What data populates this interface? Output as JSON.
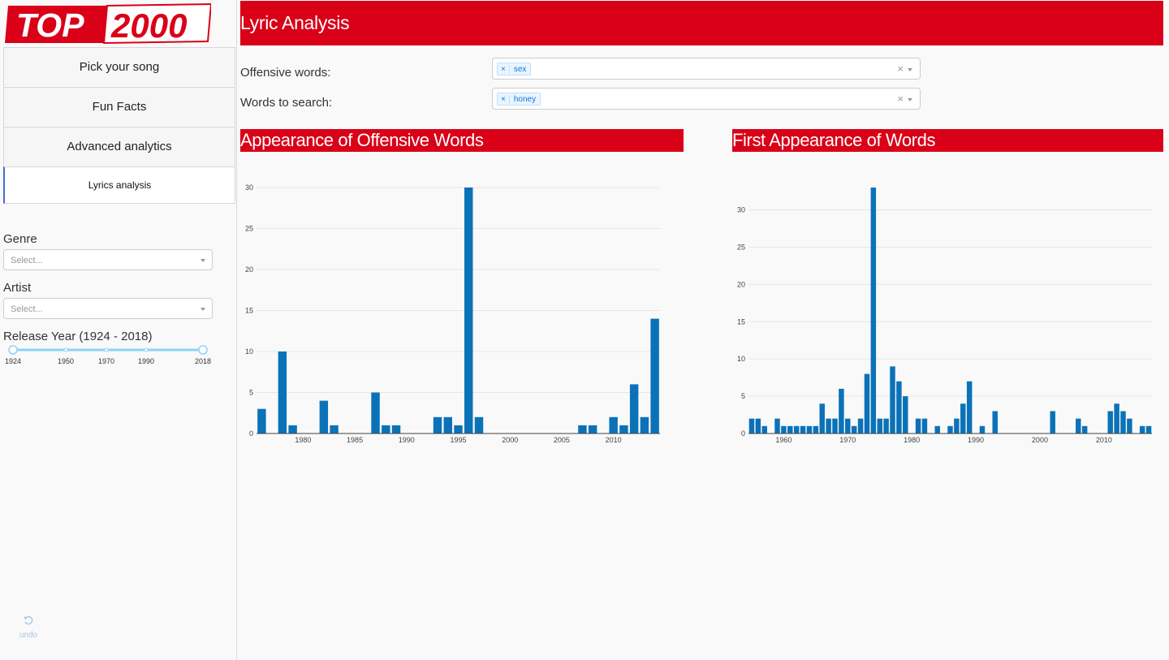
{
  "sidebar": {
    "logo": {
      "part1": "TOP",
      "part2": "2000"
    },
    "nav": [
      {
        "label": "Pick your song",
        "active": false
      },
      {
        "label": "Fun Facts",
        "active": false
      },
      {
        "label": "Advanced analytics",
        "active": false
      },
      {
        "label": "Lyrics analysis",
        "active": true
      }
    ],
    "genre": {
      "label": "Genre",
      "placeholder": "Select..."
    },
    "artist": {
      "label": "Artist",
      "placeholder": "Select..."
    },
    "release_year": {
      "label": "Release Year (1924 - 2018)",
      "min": 1924,
      "max": 2018,
      "selected": [
        1924,
        2018
      ],
      "marks": [
        "1924",
        "1950",
        "1970",
        "1990",
        "2018"
      ]
    },
    "undo_label": "undo"
  },
  "header": {
    "title": "Lyric Analysis"
  },
  "filters": {
    "offensive_label": "Offensive words:",
    "offensive_values": [
      "sex"
    ],
    "search_label": "Words to search:",
    "search_values": [
      "honey"
    ],
    "clear_glyph": "×",
    "remove_glyph": "×"
  },
  "colors": {
    "accent": "#d90018",
    "bar": "#0b72b8"
  },
  "chart_titles": {
    "left": "Appearance of Offensive Words",
    "right": "First Appearance of Words"
  },
  "chart_data": [
    {
      "type": "bar",
      "title": "Appearance of Offensive Words",
      "x_ticks": [
        1980,
        1985,
        1990,
        1995,
        2000,
        2005,
        2010
      ],
      "y_ticks": [
        0,
        5,
        10,
        15,
        20,
        25,
        30
      ],
      "xlim": [
        1975.5,
        2014.5
      ],
      "ylim": [
        0,
        30
      ],
      "grid": true,
      "x": [
        1976,
        1978,
        1979,
        1982,
        1983,
        1987,
        1988,
        1989,
        1993,
        1994,
        1995,
        1996,
        1997,
        2007,
        2008,
        2010,
        2011,
        2012,
        2013,
        2014
      ],
      "values": [
        3,
        10,
        1,
        4,
        1,
        5,
        1,
        1,
        2,
        2,
        1,
        30,
        2,
        1,
        1,
        2,
        1,
        6,
        2,
        14
      ]
    },
    {
      "type": "bar",
      "title": "First Appearance of Words",
      "x_ticks": [
        1960,
        1970,
        1980,
        1990,
        2000,
        2010
      ],
      "y_ticks": [
        0,
        5,
        10,
        15,
        20,
        25,
        30
      ],
      "xlim": [
        1954.5,
        2017.5
      ],
      "ylim": [
        0,
        33
      ],
      "grid": true,
      "x": [
        1955,
        1956,
        1957,
        1959,
        1960,
        1961,
        1962,
        1963,
        1964,
        1965,
        1966,
        1967,
        1968,
        1969,
        1970,
        1971,
        1972,
        1973,
        1974,
        1975,
        1976,
        1977,
        1978,
        1979,
        1981,
        1982,
        1984,
        1986,
        1987,
        1988,
        1989,
        1991,
        1993,
        2002,
        2006,
        2007,
        2011,
        2012,
        2013,
        2014,
        2016,
        2017
      ],
      "values": [
        2,
        2,
        1,
        2,
        1,
        1,
        1,
        1,
        1,
        1,
        4,
        2,
        2,
        6,
        2,
        1,
        2,
        8,
        33,
        2,
        2,
        9,
        7,
        5,
        2,
        2,
        1,
        1,
        2,
        4,
        7,
        1,
        3,
        3,
        2,
        1,
        3,
        4,
        3,
        2,
        1,
        1
      ]
    }
  ]
}
